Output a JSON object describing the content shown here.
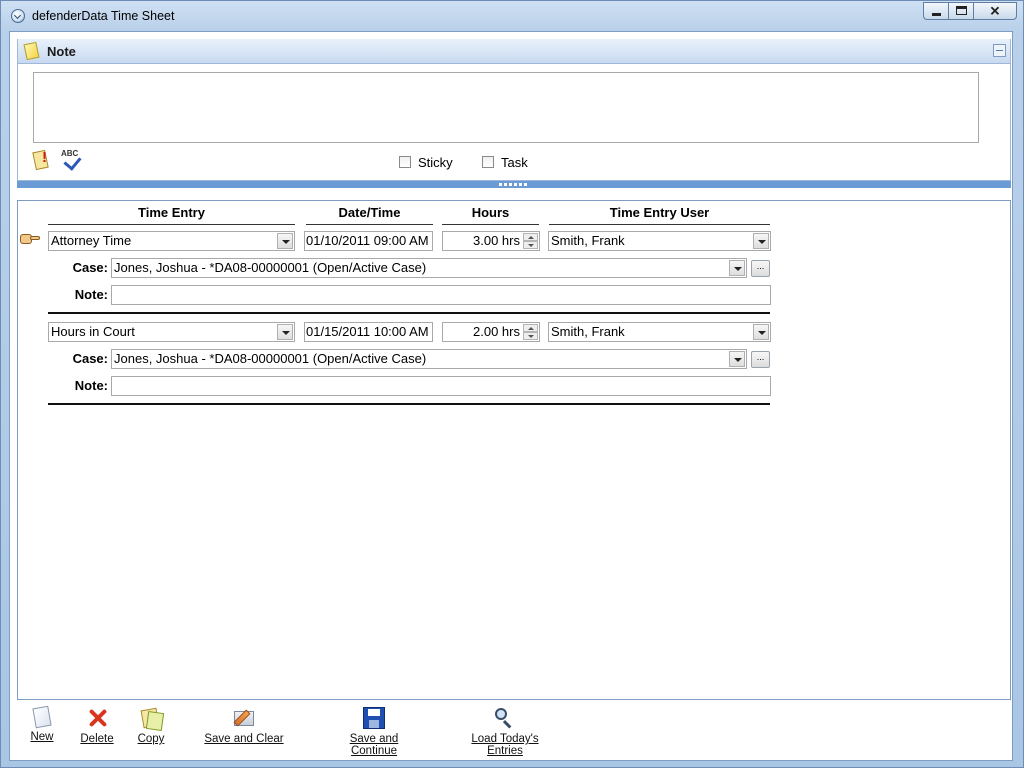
{
  "window": {
    "title": "defenderData Time Sheet"
  },
  "note_panel": {
    "title": "Note",
    "note_text": "",
    "checkboxes": [
      {
        "label": "Sticky",
        "checked": false
      },
      {
        "label": "Task",
        "checked": false
      }
    ]
  },
  "entries_header": {
    "time_entry": "Time Entry",
    "date_time": "Date/Time",
    "hours": "Hours",
    "time_entry_user": "Time Entry User"
  },
  "labels": {
    "case": "Case:",
    "note": "Note:",
    "ellipsis": "..."
  },
  "entries": [
    {
      "time_entry": "Attorney Time",
      "date_time": "01/10/2011 09:00 AM",
      "hours": "3.00 hrs",
      "user": "Smith, Frank",
      "case": "Jones, Joshua  - *DA08-00000001 (Open/Active Case)",
      "note": "",
      "selected": true
    },
    {
      "time_entry": "Hours in Court",
      "date_time": "01/15/2011 10:00 AM",
      "hours": "2.00 hrs",
      "user": "Smith, Frank",
      "case": "Jones, Joshua  - *DA08-00000001 (Open/Active Case)",
      "note": "",
      "selected": false
    }
  ],
  "toolbar": {
    "new": "New",
    "delete": "Delete",
    "copy": "Copy",
    "save_and_clear": "Save and Clear",
    "save_and_continue": "Save and Continue",
    "load_todays_entries": "Load Today's Entries"
  },
  "icons": {
    "window": "clock-icon",
    "note": "note-icon",
    "spell_check": "spell-check-icon",
    "new": "new-document-icon",
    "delete": "delete-x-icon",
    "copy": "copy-icon",
    "save_and_clear": "eraser-icon",
    "save_and_continue": "save-disk-icon",
    "load": "magnifier-icon",
    "pointer": "pointing-hand-icon"
  }
}
